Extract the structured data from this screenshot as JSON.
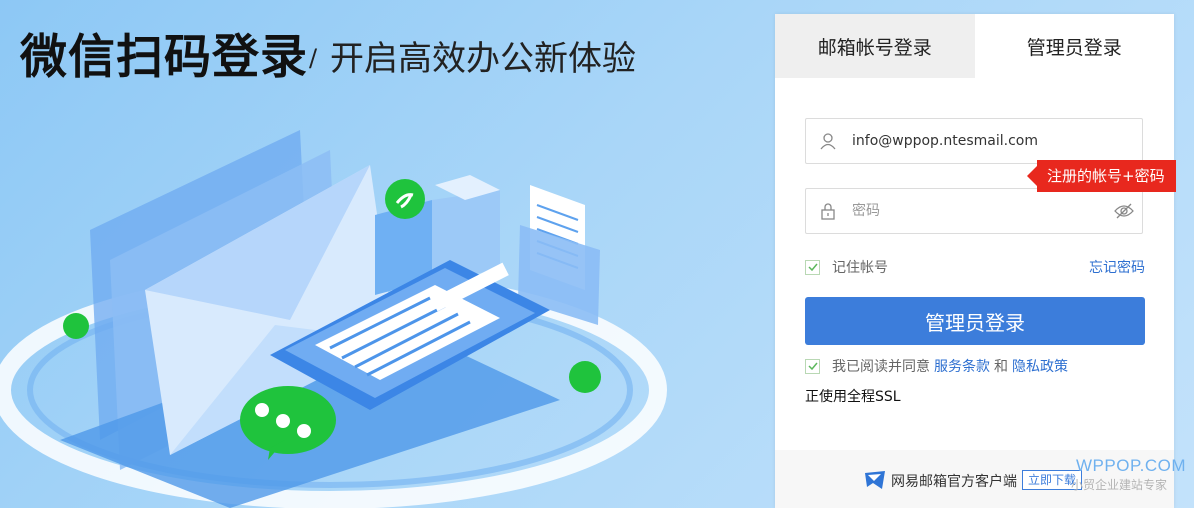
{
  "hero": {
    "title": "微信扫码登录",
    "slash": "/",
    "subtitle": "开启高效办公新体验"
  },
  "tabs": [
    {
      "label": "邮箱帐号登录",
      "active": false
    },
    {
      "label": "管理员登录",
      "active": true
    }
  ],
  "form": {
    "account_value": "info@wppop.ntesmail.com",
    "account_icon": "user-icon",
    "password_placeholder": "密码",
    "password_icon": "lock-icon",
    "eye_icon": "eye-off-icon",
    "badge": "注册的帐号+密码",
    "remember_label": "记住帐号",
    "remember_checked": true,
    "forgot_label": "忘记密码",
    "submit_label": "管理员登录",
    "agree_prefix": "我已阅读并同意",
    "terms_label": "服务条款",
    "agree_and": "和",
    "privacy_label": "隐私政策",
    "agree_checked": true,
    "ssl_text": "正使用全程SSL"
  },
  "footer": {
    "client_text": "网易邮箱官方客户端",
    "download_label": "立即下载"
  },
  "watermark": {
    "brand": "WPPOP.COM",
    "tagline": "小贸企业建站专家"
  },
  "colors": {
    "accent": "#3c7ddb",
    "badge": "#e8281e",
    "link": "#2d6fd0",
    "wechat_green": "#1fc33d"
  }
}
